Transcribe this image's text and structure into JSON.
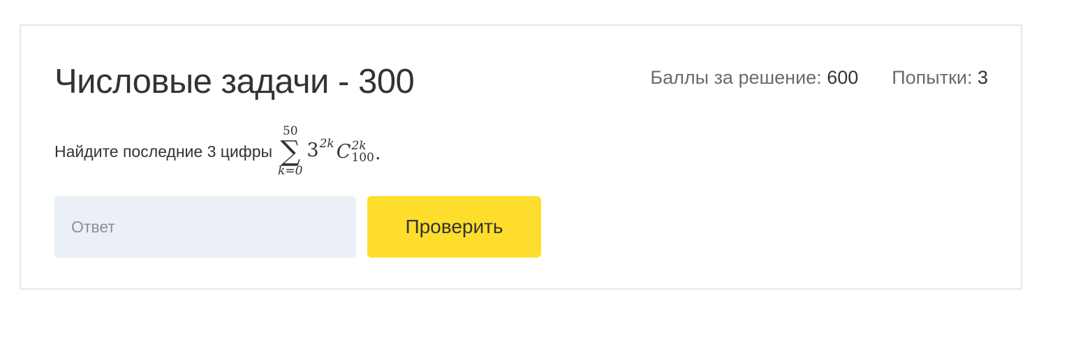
{
  "task": {
    "title": "Числовые задачи - 300",
    "meta": {
      "points_label": "Баллы за решение: ",
      "points_value": "600",
      "attempts_label": "Попытки: ",
      "attempts_value": "3"
    },
    "problem": {
      "text": "Найдите последние 3 цифры",
      "formula": {
        "sum_upper": "50",
        "sum_sign": "∑",
        "sum_lower": "k=0",
        "base": "3",
        "exponent": "2k",
        "binom_letter": "C",
        "binom_top": "2k",
        "binom_bottom": "100",
        "period": "."
      }
    },
    "answer": {
      "placeholder": "Ответ",
      "value": ""
    },
    "check_button_label": "Проверить"
  },
  "colors": {
    "button_bg": "#ffdd2d",
    "input_bg": "#ebeff6",
    "card_border": "#e6e6e6",
    "text_primary": "#333333",
    "text_secondary": "#6b6b6b"
  }
}
